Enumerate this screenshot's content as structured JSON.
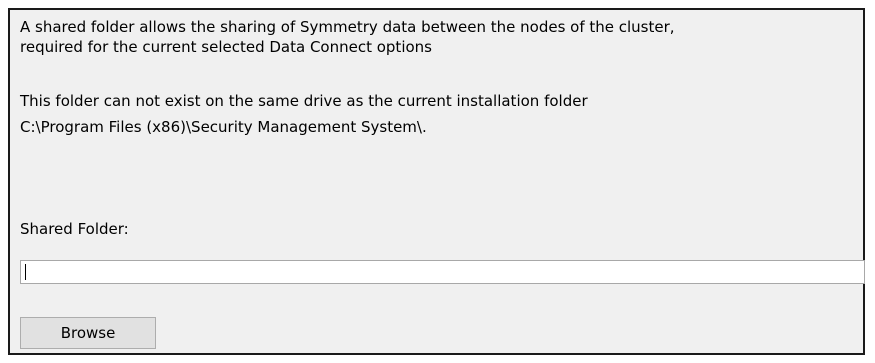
{
  "info": {
    "line1": "A shared folder allows the sharing of Symmetry data between the nodes of the cluster,",
    "line2": "required for the current selected Data Connect options",
    "line3": "This folder can not exist on the same drive as the current installation folder",
    "line4": "C:\\Program Files (x86)\\Security Management System\\."
  },
  "shared_folder": {
    "label": "Shared Folder:",
    "value": ""
  },
  "browse_button": {
    "label": "Browse"
  }
}
